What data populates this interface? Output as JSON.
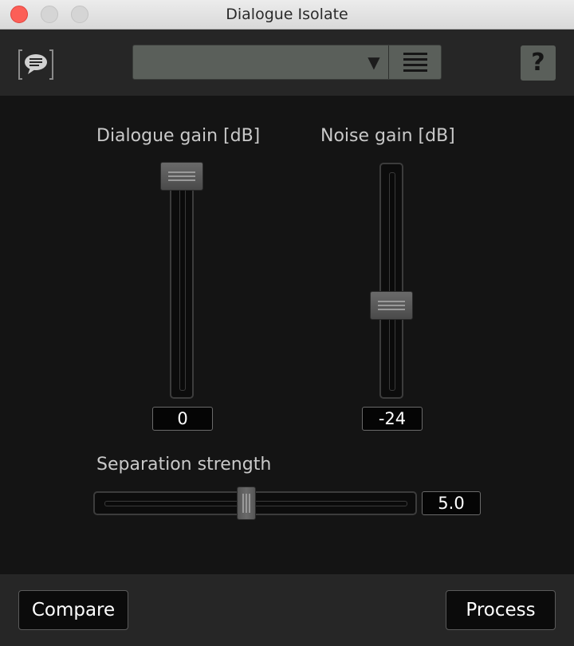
{
  "window": {
    "title": "Dialogue Isolate"
  },
  "toolbar": {
    "logo_icon": "speech-bubble-icon",
    "preset_value": "",
    "preset_arrow_icon": "triangle-down-icon",
    "preset_menu_icon": "list-menu-icon",
    "help_label": "?"
  },
  "controls": {
    "dialogue_gain": {
      "label": "Dialogue gain [dB]",
      "value": "0",
      "level": 1.0
    },
    "noise_gain": {
      "label": "Noise gain [dB]",
      "value": "-24",
      "level": 0.38
    },
    "separation_strength": {
      "label": "Separation strength",
      "value": "5.0",
      "level": 0.5
    }
  },
  "footer": {
    "compare_label": "Compare",
    "process_label": "Process"
  },
  "colors": {
    "close": "#fc5f57",
    "panel": "#141414",
    "toolbar": "#262626",
    "preset": "#5a5f5a"
  }
}
